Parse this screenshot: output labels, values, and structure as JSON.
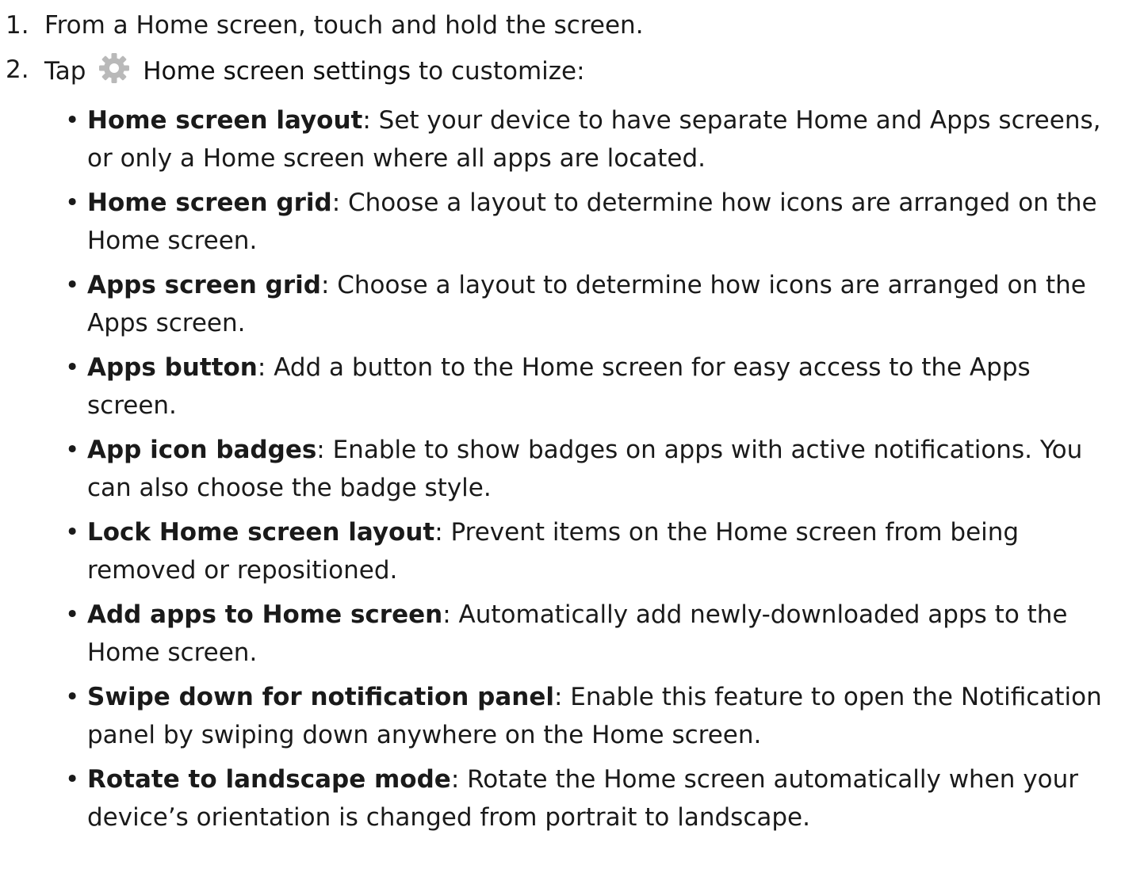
{
  "steps": [
    {
      "num": "1.",
      "text": "From a Home screen, touch and hold the screen."
    },
    {
      "num": "2.",
      "prefix": "Tap",
      "icon": "gear-icon",
      "icon_color": "#b9b9b9",
      "bold": "Home screen settings",
      "suffix": "to customize:"
    }
  ],
  "options": [
    {
      "name": "Home screen layout",
      "desc": ": Set your device to have separate Home and Apps screens, or only a Home screen where all apps are located."
    },
    {
      "name": "Home screen grid",
      "desc": ": Choose a layout to determine how icons are arranged on the Home screen."
    },
    {
      "name": "Apps screen grid",
      "desc": ": Choose a layout to determine how icons are arranged on the Apps screen."
    },
    {
      "name": "Apps button",
      "desc": ": Add a button to the Home screen for easy access to the Apps screen."
    },
    {
      "name": "App icon badges",
      "desc": ": Enable to show badges on apps with active notifications. You can also choose the badge style."
    },
    {
      "name": "Lock Home screen layout",
      "desc": ": Prevent items on the Home screen from being removed or repositioned."
    },
    {
      "name": "Add apps to Home screen",
      "desc": ": Automatically add newly-downloaded apps to the Home screen."
    },
    {
      "name": "Swipe down for notification panel",
      "desc": ": Enable this feature to open the Notification panel by swiping down anywhere on the Home screen."
    },
    {
      "name": "Rotate to landscape mode",
      "desc": ": Rotate the Home screen automatically when your device’s orientation is changed from portrait to landscape."
    }
  ],
  "bullet_char": "•"
}
